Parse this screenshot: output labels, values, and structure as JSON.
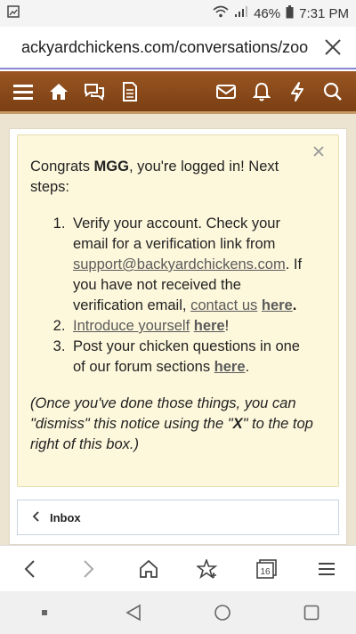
{
  "status_bar": {
    "battery": "46%",
    "time": "7:31 PM"
  },
  "browser": {
    "url": "ackyardchickens.com/conversations/zoo"
  },
  "notice": {
    "intro_prefix": "Congrats ",
    "username": "MGG",
    "intro_suffix": ", you're logged in! Next steps:",
    "step1_text": "Verify your account. Check your email for a verification link from ",
    "step1_email": "support@backyardchickens.com",
    "step1_text2": ". If you have not received the verification email, ",
    "step1_contact": "contact us",
    "step1_here": "here",
    "step1_end": ".",
    "step2_link": "Introduce yourself",
    "step2_here": "here",
    "step2_end": "!",
    "step3_text": "Post your chicken questions in one of our forum sections ",
    "step3_here": "here",
    "step3_end": ".",
    "footnote_a": "(Once you've done those things, you can \"dismiss\" this notice using the \"",
    "footnote_x": "X",
    "footnote_b": "\" to the top right of this box.)"
  },
  "inbox": {
    "label": "Inbox"
  },
  "browser_bar": {
    "tab_count": "16"
  }
}
